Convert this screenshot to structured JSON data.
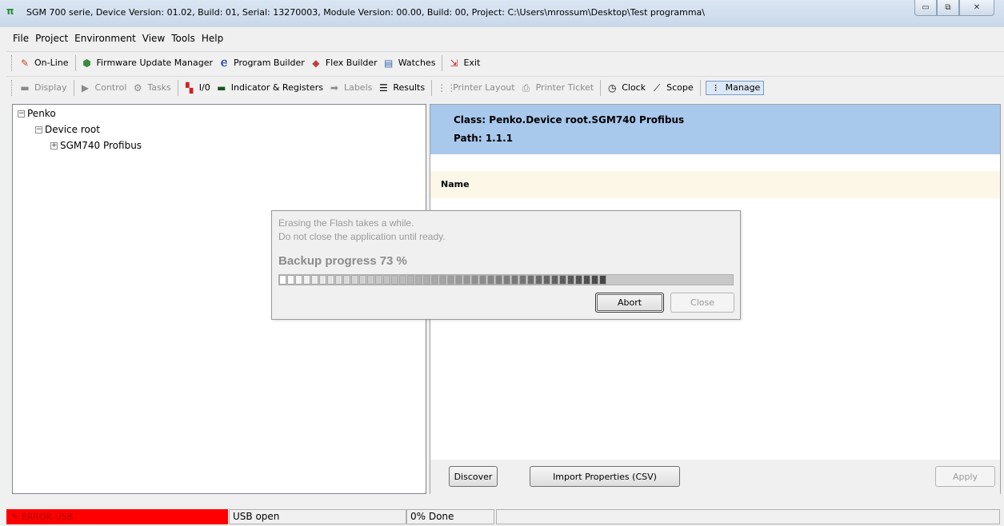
{
  "window": {
    "title": "SGM 700 serie, Device Version: 01.02, Build: 01, Serial: 13270003, Module Version: 00.00, Build: 00, Project: C:\\Users\\mrossum\\Desktop\\Test programma\\",
    "minimize": "▭",
    "restore": "⧉",
    "close": "✕"
  },
  "menu": [
    "File",
    "Project",
    "Environment",
    "View",
    "Tools",
    "Help"
  ],
  "toolbar1": {
    "online": "On-Line",
    "firmware": "Firmware Update Manager",
    "program_builder": "Program Builder",
    "flex_builder": "Flex Builder",
    "watches": "Watches",
    "exit": "Exit"
  },
  "toolbar2": {
    "display": "Display",
    "control": "Control",
    "tasks": "Tasks",
    "io": "I/0",
    "indicator": "Indicator & Registers",
    "labels": "Labels",
    "results": "Results",
    "printer_layout": "Printer Layout",
    "printer_ticket": "Printer Ticket",
    "clock": "Clock",
    "scope": "Scope",
    "manage": "Manage"
  },
  "tree": {
    "root": "Penko",
    "device_root": "Device root",
    "child": "SGM740 Profibus"
  },
  "detail": {
    "class_line": "Class: Penko.Device root.SGM740 Profibus",
    "path_line": "Path: 1.1.1",
    "name_header": "Name",
    "discover": "Discover",
    "import": "Import Properties (CSV)",
    "apply": "Apply"
  },
  "dialog": {
    "msg1": "Erasing the Flash takes a while.",
    "msg2": "Do not close the application until ready.",
    "progress_label": "Backup progress 73 %",
    "progress_value": 0.73,
    "abort": "Abort",
    "close": "Close"
  },
  "status": {
    "error": "ERROR USB",
    "usb": "USB open",
    "done": "0% Done"
  }
}
